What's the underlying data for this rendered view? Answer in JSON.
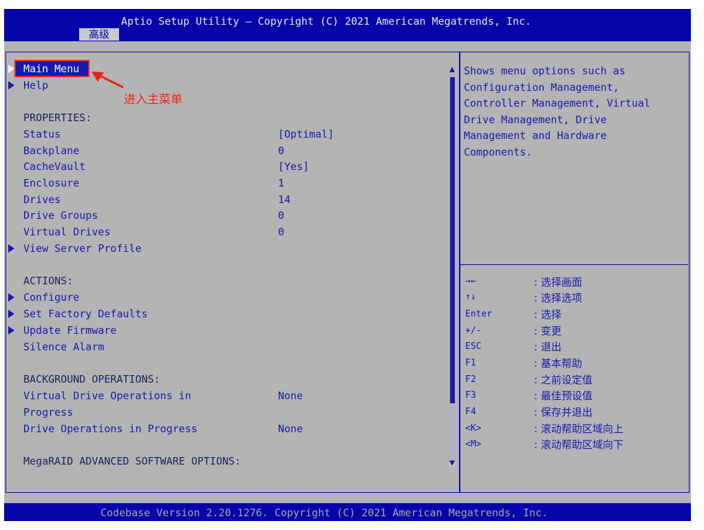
{
  "header": {
    "title": "Aptio Setup Utility – Copyright (C) 2021 American Megatrends, Inc.",
    "tab": "高级"
  },
  "menu": {
    "main_menu": "Main Menu",
    "help": "Help",
    "properties_heading": "PROPERTIES:",
    "properties": [
      {
        "label": "Status",
        "value": "[Optimal]"
      },
      {
        "label": "Backplane",
        "value": "0"
      },
      {
        "label": "CacheVault",
        "value": "[Yes]"
      },
      {
        "label": "Enclosure",
        "value": "1"
      },
      {
        "label": "Drives",
        "value": "14"
      },
      {
        "label": "Drive Groups",
        "value": "0"
      },
      {
        "label": "Virtual Drives",
        "value": "0"
      }
    ],
    "view_server_profile": "View Server Profile",
    "actions_heading": "ACTIONS:",
    "actions": [
      "Configure",
      "Set Factory Defaults",
      "Update Firmware"
    ],
    "silence_alarm": "Silence Alarm",
    "bg_heading": "BACKGROUND OPERATIONS:",
    "vd_ops_label_1": "Virtual Drive Operations in",
    "vd_ops_label_2": "Progress",
    "vd_ops_value": "None",
    "drive_ops_label": "Drive Operations in Progress",
    "drive_ops_value": "None",
    "megaraid_heading": "MegaRAID ADVANCED SOFTWARE OPTIONS:"
  },
  "annotation": {
    "text": "进入主菜单",
    "color": "#e8231c"
  },
  "help_text": "Shows menu options such as\nConfiguration Management,\nController Management, Virtual\nDrive Management, Drive\nManagement and Hardware\nComponents.",
  "keys": [
    {
      "key": "→←",
      "desc": ": 选择画面"
    },
    {
      "key": "↑↓",
      "desc": ": 选择选项"
    },
    {
      "key": "Enter",
      "desc": ": 选择"
    },
    {
      "key": "+/-",
      "desc": ": 变更"
    },
    {
      "key": "ESC",
      "desc": ": 退出"
    },
    {
      "key": "F1",
      "desc": ": 基本帮助"
    },
    {
      "key": "F2",
      "desc": ": 之前设定值"
    },
    {
      "key": "F3",
      "desc": ": 最佳预设值"
    },
    {
      "key": "F4",
      "desc": ": 保存并退出"
    },
    {
      "key": "<K>",
      "desc": ": 滚动帮助区域向上"
    },
    {
      "key": "<M>",
      "desc": ": 滚动帮助区域向下"
    }
  ],
  "footer": "Codebase Version 2.20.1276. Copyright (C) 2021 American Megatrends, Inc.",
  "colors": {
    "header_bg": "#0505a8",
    "body_bg": "#b4b4b4",
    "text_blue": "#1818b0",
    "annotation_red": "#e8231c"
  }
}
